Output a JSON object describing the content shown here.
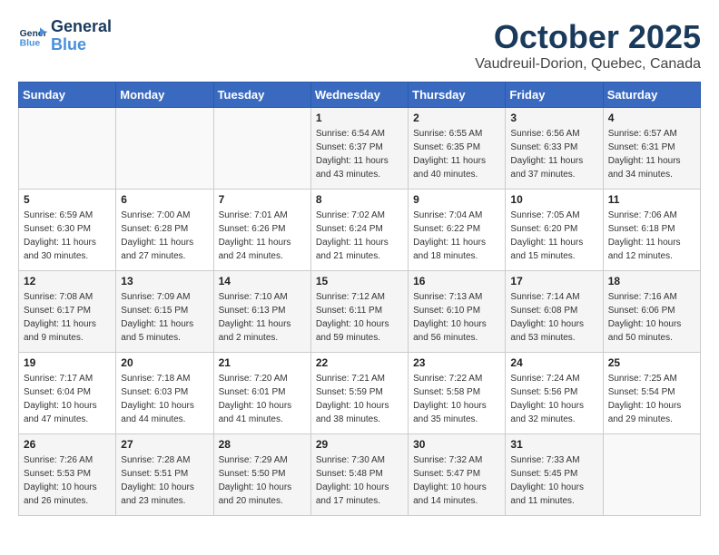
{
  "header": {
    "logo_line1": "General",
    "logo_line2": "Blue",
    "title": "October 2025",
    "subtitle": "Vaudreuil-Dorion, Quebec, Canada"
  },
  "weekdays": [
    "Sunday",
    "Monday",
    "Tuesday",
    "Wednesday",
    "Thursday",
    "Friday",
    "Saturday"
  ],
  "weeks": [
    [
      {
        "day": "",
        "info": ""
      },
      {
        "day": "",
        "info": ""
      },
      {
        "day": "",
        "info": ""
      },
      {
        "day": "1",
        "info": "Sunrise: 6:54 AM\nSunset: 6:37 PM\nDaylight: 11 hours\nand 43 minutes."
      },
      {
        "day": "2",
        "info": "Sunrise: 6:55 AM\nSunset: 6:35 PM\nDaylight: 11 hours\nand 40 minutes."
      },
      {
        "day": "3",
        "info": "Sunrise: 6:56 AM\nSunset: 6:33 PM\nDaylight: 11 hours\nand 37 minutes."
      },
      {
        "day": "4",
        "info": "Sunrise: 6:57 AM\nSunset: 6:31 PM\nDaylight: 11 hours\nand 34 minutes."
      }
    ],
    [
      {
        "day": "5",
        "info": "Sunrise: 6:59 AM\nSunset: 6:30 PM\nDaylight: 11 hours\nand 30 minutes."
      },
      {
        "day": "6",
        "info": "Sunrise: 7:00 AM\nSunset: 6:28 PM\nDaylight: 11 hours\nand 27 minutes."
      },
      {
        "day": "7",
        "info": "Sunrise: 7:01 AM\nSunset: 6:26 PM\nDaylight: 11 hours\nand 24 minutes."
      },
      {
        "day": "8",
        "info": "Sunrise: 7:02 AM\nSunset: 6:24 PM\nDaylight: 11 hours\nand 21 minutes."
      },
      {
        "day": "9",
        "info": "Sunrise: 7:04 AM\nSunset: 6:22 PM\nDaylight: 11 hours\nand 18 minutes."
      },
      {
        "day": "10",
        "info": "Sunrise: 7:05 AM\nSunset: 6:20 PM\nDaylight: 11 hours\nand 15 minutes."
      },
      {
        "day": "11",
        "info": "Sunrise: 7:06 AM\nSunset: 6:18 PM\nDaylight: 11 hours\nand 12 minutes."
      }
    ],
    [
      {
        "day": "12",
        "info": "Sunrise: 7:08 AM\nSunset: 6:17 PM\nDaylight: 11 hours\nand 9 minutes."
      },
      {
        "day": "13",
        "info": "Sunrise: 7:09 AM\nSunset: 6:15 PM\nDaylight: 11 hours\nand 5 minutes."
      },
      {
        "day": "14",
        "info": "Sunrise: 7:10 AM\nSunset: 6:13 PM\nDaylight: 11 hours\nand 2 minutes."
      },
      {
        "day": "15",
        "info": "Sunrise: 7:12 AM\nSunset: 6:11 PM\nDaylight: 10 hours\nand 59 minutes."
      },
      {
        "day": "16",
        "info": "Sunrise: 7:13 AM\nSunset: 6:10 PM\nDaylight: 10 hours\nand 56 minutes."
      },
      {
        "day": "17",
        "info": "Sunrise: 7:14 AM\nSunset: 6:08 PM\nDaylight: 10 hours\nand 53 minutes."
      },
      {
        "day": "18",
        "info": "Sunrise: 7:16 AM\nSunset: 6:06 PM\nDaylight: 10 hours\nand 50 minutes."
      }
    ],
    [
      {
        "day": "19",
        "info": "Sunrise: 7:17 AM\nSunset: 6:04 PM\nDaylight: 10 hours\nand 47 minutes."
      },
      {
        "day": "20",
        "info": "Sunrise: 7:18 AM\nSunset: 6:03 PM\nDaylight: 10 hours\nand 44 minutes."
      },
      {
        "day": "21",
        "info": "Sunrise: 7:20 AM\nSunset: 6:01 PM\nDaylight: 10 hours\nand 41 minutes."
      },
      {
        "day": "22",
        "info": "Sunrise: 7:21 AM\nSunset: 5:59 PM\nDaylight: 10 hours\nand 38 minutes."
      },
      {
        "day": "23",
        "info": "Sunrise: 7:22 AM\nSunset: 5:58 PM\nDaylight: 10 hours\nand 35 minutes."
      },
      {
        "day": "24",
        "info": "Sunrise: 7:24 AM\nSunset: 5:56 PM\nDaylight: 10 hours\nand 32 minutes."
      },
      {
        "day": "25",
        "info": "Sunrise: 7:25 AM\nSunset: 5:54 PM\nDaylight: 10 hours\nand 29 minutes."
      }
    ],
    [
      {
        "day": "26",
        "info": "Sunrise: 7:26 AM\nSunset: 5:53 PM\nDaylight: 10 hours\nand 26 minutes."
      },
      {
        "day": "27",
        "info": "Sunrise: 7:28 AM\nSunset: 5:51 PM\nDaylight: 10 hours\nand 23 minutes."
      },
      {
        "day": "28",
        "info": "Sunrise: 7:29 AM\nSunset: 5:50 PM\nDaylight: 10 hours\nand 20 minutes."
      },
      {
        "day": "29",
        "info": "Sunrise: 7:30 AM\nSunset: 5:48 PM\nDaylight: 10 hours\nand 17 minutes."
      },
      {
        "day": "30",
        "info": "Sunrise: 7:32 AM\nSunset: 5:47 PM\nDaylight: 10 hours\nand 14 minutes."
      },
      {
        "day": "31",
        "info": "Sunrise: 7:33 AM\nSunset: 5:45 PM\nDaylight: 10 hours\nand 11 minutes."
      },
      {
        "day": "",
        "info": ""
      }
    ]
  ]
}
